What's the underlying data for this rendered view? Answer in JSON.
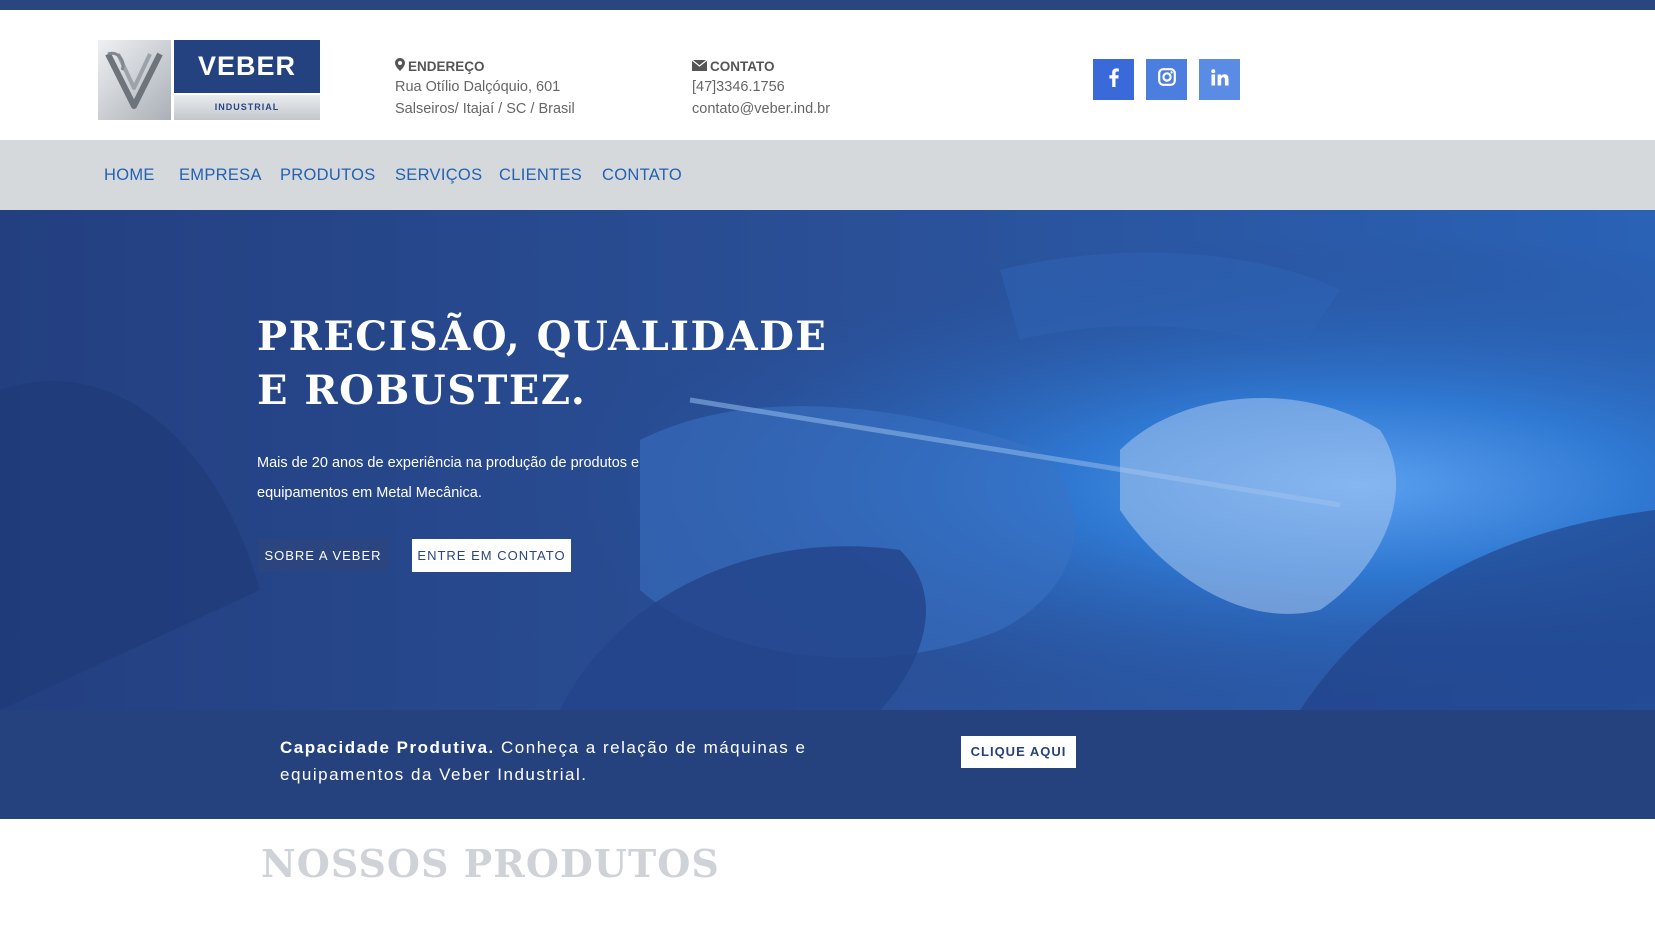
{
  "brand": {
    "name": "VEBER",
    "sub": "INDUSTRIAL",
    "colors": {
      "primary": "#2a4580",
      "nav_link": "#2361b3",
      "social": "#3a6ad9",
      "nav_bg": "#d6d9dc"
    }
  },
  "header": {
    "address": {
      "icon": "map-marker-icon",
      "title": "ENDEREÇO",
      "line1": "Rua Otílio Dalçóquio, 601",
      "line2": "Salseiros/ Itajaí / SC / Brasil"
    },
    "contact": {
      "icon": "envelope-icon",
      "title": "CONTATO",
      "phone": "[47]3346.1756",
      "email": "contato@veber.ind.br"
    },
    "social": [
      "facebook-icon",
      "instagram-icon",
      "linkedin-icon"
    ]
  },
  "nav": {
    "items": [
      "HOME",
      "EMPRESA",
      "PRODUTOS",
      "SERVIÇOS",
      "CLIENTES",
      "CONTATO"
    ]
  },
  "hero": {
    "title_line1": "PRECISÃO, QUALIDADE",
    "title_line2": "E ROBUSTEZ.",
    "text": "Mais de 20 anos de experiência na produção de produtos e equipamentos em Metal Mecânica.",
    "btn_about": "SOBRE A VEBER",
    "btn_contact": "ENTRE EM CONTATO"
  },
  "banner": {
    "strong": "Capacidade Produtiva.",
    "text": " Conheça a relação de máquinas e equipamentos da Veber Industrial.",
    "button": "CLIQUE AQUI"
  },
  "products": {
    "title": "NOSSOS PRODUTOS"
  }
}
